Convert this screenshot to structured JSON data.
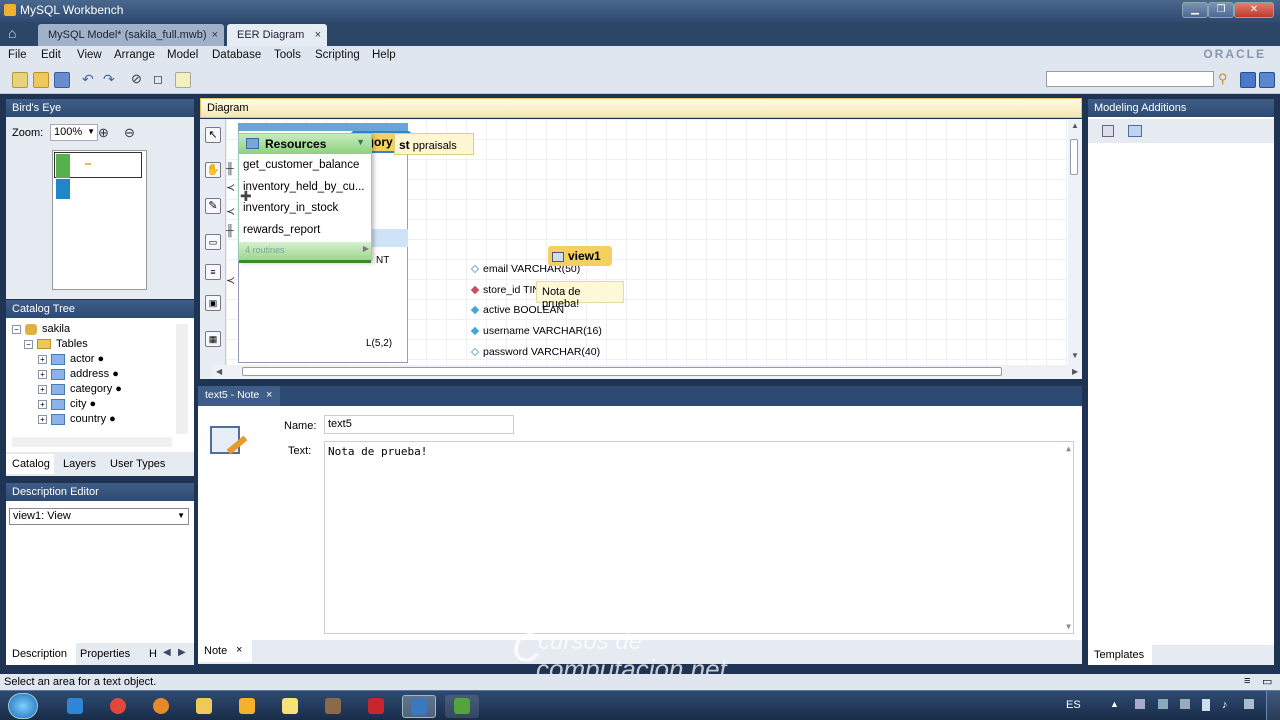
{
  "window": {
    "title": "MySQL Workbench"
  },
  "tabs": [
    {
      "label": "MySQL Model* (sakila_full.mwb)"
    },
    {
      "label": "EER Diagram"
    }
  ],
  "menu": [
    "File",
    "Edit",
    "View",
    "Arrange",
    "Model",
    "Database",
    "Tools",
    "Scripting",
    "Help"
  ],
  "brand": "ORACLE",
  "birds_eye": {
    "title": "Bird's Eye",
    "zoom_label": "Zoom:",
    "zoom_value": "100%"
  },
  "catalog": {
    "title": "Catalog Tree",
    "schema": "sakila",
    "folder": "Tables",
    "tables": [
      "actor ●",
      "address ●",
      "category ●",
      "city ●",
      "country ●"
    ],
    "tabs": [
      "Catalog",
      "Layers",
      "User Types"
    ]
  },
  "description": {
    "title": "Description Editor",
    "selected": "view1: View",
    "tabs": [
      "Description",
      "Properties",
      "H"
    ]
  },
  "diagram": {
    "title": "Diagram",
    "routine_group": {
      "title": "Resources",
      "items": [
        "get_customer_balance",
        "inventory_held_by_cu...",
        "inventory_in_stock",
        "rewards_report"
      ],
      "footer": "4 routines"
    },
    "columns": [
      "email VARCHAR(50)",
      "store_id TINYINT",
      "active BOOLEAN",
      "username VARCHAR(16)",
      "password VARCHAR(40)"
    ],
    "behind_labels": [
      "egory",
      "st",
      "ppraisals",
      "T",
      "NT",
      "L(5,2)"
    ],
    "view_label": "view1",
    "note_text": "Nota de prueba!"
  },
  "editor": {
    "tab_title": "text5 - Note",
    "name_label": "Name:",
    "name_value": "text5",
    "text_label": "Text:",
    "text_value": "Nota de prueba!",
    "bottom_tab": "Note"
  },
  "modeling": {
    "title": "Modeling Additions",
    "bottom_tab": "Templates"
  },
  "status": "Select an area for a text object.",
  "watermark": {
    "line1": "cursos de",
    "line2": "computacion.net"
  },
  "tray": {
    "lang": "ES"
  }
}
